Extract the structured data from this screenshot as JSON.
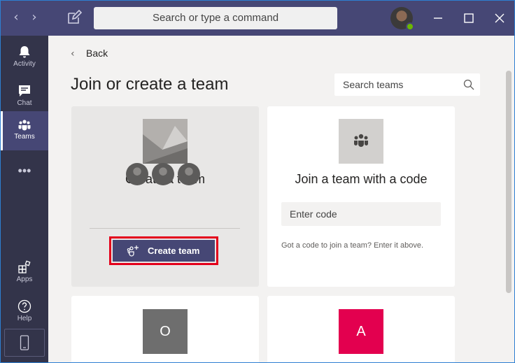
{
  "titlebar": {
    "back_arrow": "‹",
    "forward_arrow": "›",
    "search_placeholder": "Search or type a command"
  },
  "rail": {
    "items": [
      {
        "label": "Activity",
        "icon": "bell-icon"
      },
      {
        "label": "Chat",
        "icon": "chat-icon"
      },
      {
        "label": "Teams",
        "icon": "teams-icon",
        "active": true
      },
      {
        "label": "Apps",
        "icon": "apps-icon"
      },
      {
        "label": "Help",
        "icon": "help-icon"
      }
    ],
    "more": "•••"
  },
  "main": {
    "back_label": "Back",
    "page_title": "Join or create a team",
    "search_teams_placeholder": "Search teams",
    "create_card": {
      "title": "Create a team",
      "button_label": "Create team"
    },
    "join_card": {
      "title": "Join a team with a code",
      "code_placeholder": "Enter code",
      "hint": "Got a code to join a team? Enter it above."
    },
    "tiles": [
      {
        "letter": "O",
        "color": "#6e6e6e"
      },
      {
        "letter": "A",
        "color": "#e3004f"
      }
    ]
  },
  "colors": {
    "brand": "#464775",
    "rail": "#33344a",
    "highlight": "#e3001b",
    "online": "#6bb700"
  }
}
